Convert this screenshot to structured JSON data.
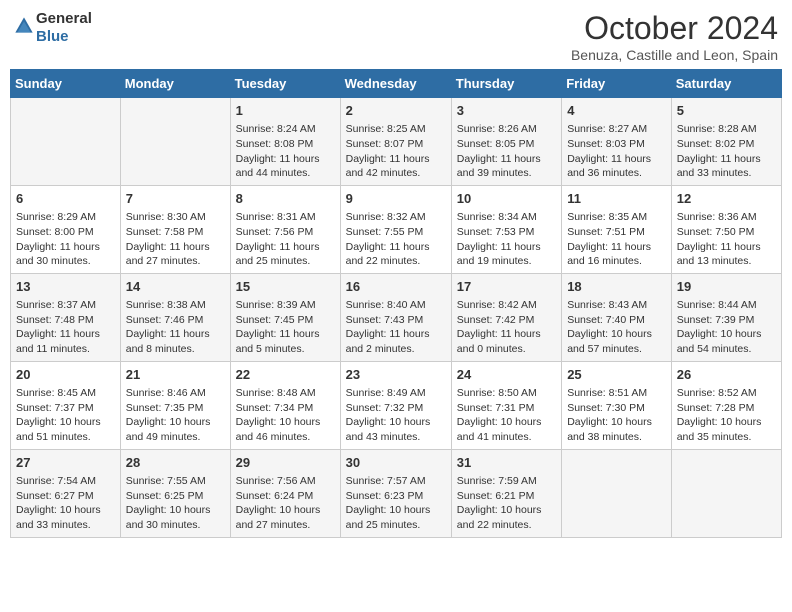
{
  "header": {
    "logo_line1": "General",
    "logo_line2": "Blue",
    "month": "October 2024",
    "location": "Benuza, Castille and Leon, Spain"
  },
  "days_of_week": [
    "Sunday",
    "Monday",
    "Tuesday",
    "Wednesday",
    "Thursday",
    "Friday",
    "Saturday"
  ],
  "weeks": [
    [
      {
        "day": "",
        "content": ""
      },
      {
        "day": "",
        "content": ""
      },
      {
        "day": "1",
        "content": "Sunrise: 8:24 AM\nSunset: 8:08 PM\nDaylight: 11 hours and 44 minutes."
      },
      {
        "day": "2",
        "content": "Sunrise: 8:25 AM\nSunset: 8:07 PM\nDaylight: 11 hours and 42 minutes."
      },
      {
        "day": "3",
        "content": "Sunrise: 8:26 AM\nSunset: 8:05 PM\nDaylight: 11 hours and 39 minutes."
      },
      {
        "day": "4",
        "content": "Sunrise: 8:27 AM\nSunset: 8:03 PM\nDaylight: 11 hours and 36 minutes."
      },
      {
        "day": "5",
        "content": "Sunrise: 8:28 AM\nSunset: 8:02 PM\nDaylight: 11 hours and 33 minutes."
      }
    ],
    [
      {
        "day": "6",
        "content": "Sunrise: 8:29 AM\nSunset: 8:00 PM\nDaylight: 11 hours and 30 minutes."
      },
      {
        "day": "7",
        "content": "Sunrise: 8:30 AM\nSunset: 7:58 PM\nDaylight: 11 hours and 27 minutes."
      },
      {
        "day": "8",
        "content": "Sunrise: 8:31 AM\nSunset: 7:56 PM\nDaylight: 11 hours and 25 minutes."
      },
      {
        "day": "9",
        "content": "Sunrise: 8:32 AM\nSunset: 7:55 PM\nDaylight: 11 hours and 22 minutes."
      },
      {
        "day": "10",
        "content": "Sunrise: 8:34 AM\nSunset: 7:53 PM\nDaylight: 11 hours and 19 minutes."
      },
      {
        "day": "11",
        "content": "Sunrise: 8:35 AM\nSunset: 7:51 PM\nDaylight: 11 hours and 16 minutes."
      },
      {
        "day": "12",
        "content": "Sunrise: 8:36 AM\nSunset: 7:50 PM\nDaylight: 11 hours and 13 minutes."
      }
    ],
    [
      {
        "day": "13",
        "content": "Sunrise: 8:37 AM\nSunset: 7:48 PM\nDaylight: 11 hours and 11 minutes."
      },
      {
        "day": "14",
        "content": "Sunrise: 8:38 AM\nSunset: 7:46 PM\nDaylight: 11 hours and 8 minutes."
      },
      {
        "day": "15",
        "content": "Sunrise: 8:39 AM\nSunset: 7:45 PM\nDaylight: 11 hours and 5 minutes."
      },
      {
        "day": "16",
        "content": "Sunrise: 8:40 AM\nSunset: 7:43 PM\nDaylight: 11 hours and 2 minutes."
      },
      {
        "day": "17",
        "content": "Sunrise: 8:42 AM\nSunset: 7:42 PM\nDaylight: 11 hours and 0 minutes."
      },
      {
        "day": "18",
        "content": "Sunrise: 8:43 AM\nSunset: 7:40 PM\nDaylight: 10 hours and 57 minutes."
      },
      {
        "day": "19",
        "content": "Sunrise: 8:44 AM\nSunset: 7:39 PM\nDaylight: 10 hours and 54 minutes."
      }
    ],
    [
      {
        "day": "20",
        "content": "Sunrise: 8:45 AM\nSunset: 7:37 PM\nDaylight: 10 hours and 51 minutes."
      },
      {
        "day": "21",
        "content": "Sunrise: 8:46 AM\nSunset: 7:35 PM\nDaylight: 10 hours and 49 minutes."
      },
      {
        "day": "22",
        "content": "Sunrise: 8:48 AM\nSunset: 7:34 PM\nDaylight: 10 hours and 46 minutes."
      },
      {
        "day": "23",
        "content": "Sunrise: 8:49 AM\nSunset: 7:32 PM\nDaylight: 10 hours and 43 minutes."
      },
      {
        "day": "24",
        "content": "Sunrise: 8:50 AM\nSunset: 7:31 PM\nDaylight: 10 hours and 41 minutes."
      },
      {
        "day": "25",
        "content": "Sunrise: 8:51 AM\nSunset: 7:30 PM\nDaylight: 10 hours and 38 minutes."
      },
      {
        "day": "26",
        "content": "Sunrise: 8:52 AM\nSunset: 7:28 PM\nDaylight: 10 hours and 35 minutes."
      }
    ],
    [
      {
        "day": "27",
        "content": "Sunrise: 7:54 AM\nSunset: 6:27 PM\nDaylight: 10 hours and 33 minutes."
      },
      {
        "day": "28",
        "content": "Sunrise: 7:55 AM\nSunset: 6:25 PM\nDaylight: 10 hours and 30 minutes."
      },
      {
        "day": "29",
        "content": "Sunrise: 7:56 AM\nSunset: 6:24 PM\nDaylight: 10 hours and 27 minutes."
      },
      {
        "day": "30",
        "content": "Sunrise: 7:57 AM\nSunset: 6:23 PM\nDaylight: 10 hours and 25 minutes."
      },
      {
        "day": "31",
        "content": "Sunrise: 7:59 AM\nSunset: 6:21 PM\nDaylight: 10 hours and 22 minutes."
      },
      {
        "day": "",
        "content": ""
      },
      {
        "day": "",
        "content": ""
      }
    ]
  ]
}
